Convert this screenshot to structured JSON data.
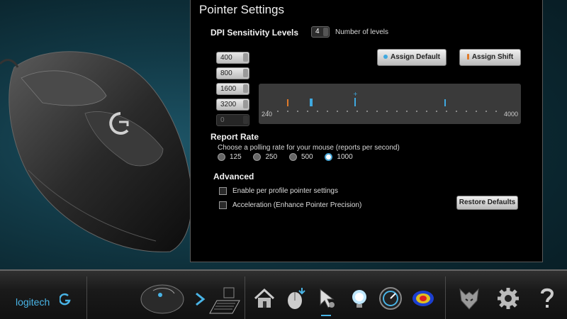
{
  "panel": {
    "title": "Pointer Settings",
    "dpi_section": {
      "heading": "DPI Sensitivity Levels",
      "levels_value": "4",
      "levels_caption": "Number of levels",
      "levels": [
        "400",
        "800",
        "1600",
        "3200",
        "0"
      ],
      "assign_default_label": "Assign Default",
      "assign_shift_label": "Assign Shift",
      "range_min": "240",
      "range_max": "4000",
      "default_color": "#3fa9e0",
      "shift_color": "#e07a2a"
    },
    "report_rate": {
      "heading": "Report Rate",
      "description": "Choose a polling rate for your mouse (reports per second)",
      "options": [
        "125",
        "250",
        "500",
        "1000"
      ],
      "selected": "1000"
    },
    "advanced": {
      "heading": "Advanced",
      "per_profile_label": "Enable per profile pointer settings",
      "acceleration_label": "Acceleration (Enhance Pointer Precision)",
      "restore_label": "Restore Defaults"
    }
  },
  "bottombar": {
    "logo_text": "logitech",
    "icons": [
      "mouse-device-icon",
      "arrow-right-icon",
      "keyboard-icon",
      "home-icon",
      "button-assign-icon",
      "pointer-settings-icon",
      "lighting-icon",
      "performance-gauge-icon",
      "heatmap-icon",
      "wolf-icon",
      "settings-gear-icon",
      "help-icon"
    ],
    "active": "pointer-settings-icon"
  }
}
